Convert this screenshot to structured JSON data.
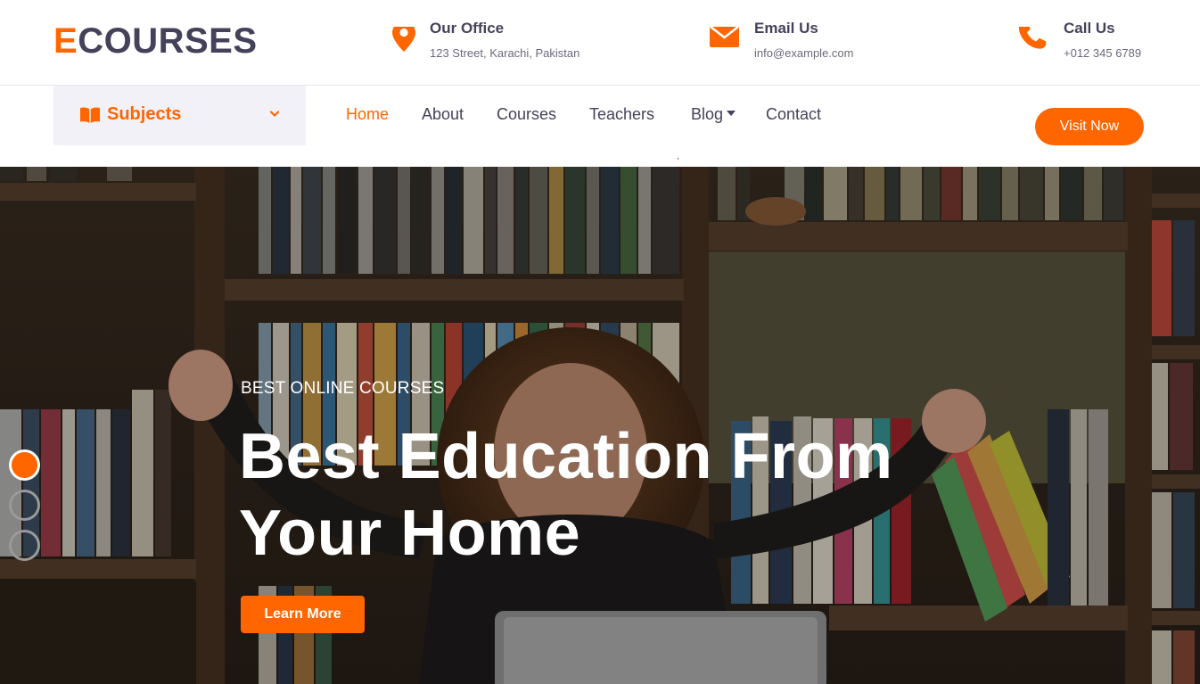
{
  "brand": {
    "first_letter": "E",
    "rest": "COURSES"
  },
  "contacts": {
    "office": {
      "icon": "map-marker-icon",
      "title": "Our Office",
      "value": "123 Street, Karachi, Pakistan"
    },
    "email": {
      "icon": "envelope-icon",
      "title": "Email Us",
      "value": "info@example.com"
    },
    "call": {
      "icon": "phone-icon",
      "title": "Call Us",
      "value": "+012 345 6789"
    }
  },
  "subjects": {
    "label": "Subjects",
    "icon": "book-open-icon",
    "chevron": "chevron-down-icon"
  },
  "nav": {
    "items": [
      {
        "label": "Home",
        "active": true
      },
      {
        "label": "About",
        "active": false
      },
      {
        "label": "Courses",
        "active": false
      },
      {
        "label": "Teachers",
        "active": false
      },
      {
        "label": "Blog",
        "active": false,
        "dropdown": true
      },
      {
        "label": "Contact",
        "active": false
      }
    ],
    "stray_mark": ",",
    "cta": "Visit Now"
  },
  "hero": {
    "eyebrow": "BEST ONLINE COURSES",
    "headline": "Best Education From Your Home",
    "button": "Learn More",
    "slides": {
      "count": 3,
      "active": 1
    }
  },
  "colors": {
    "accent": "#ff6600",
    "text_dark": "#44425a",
    "subjects_bg": "#f2f1f8",
    "white": "#ffffff"
  }
}
